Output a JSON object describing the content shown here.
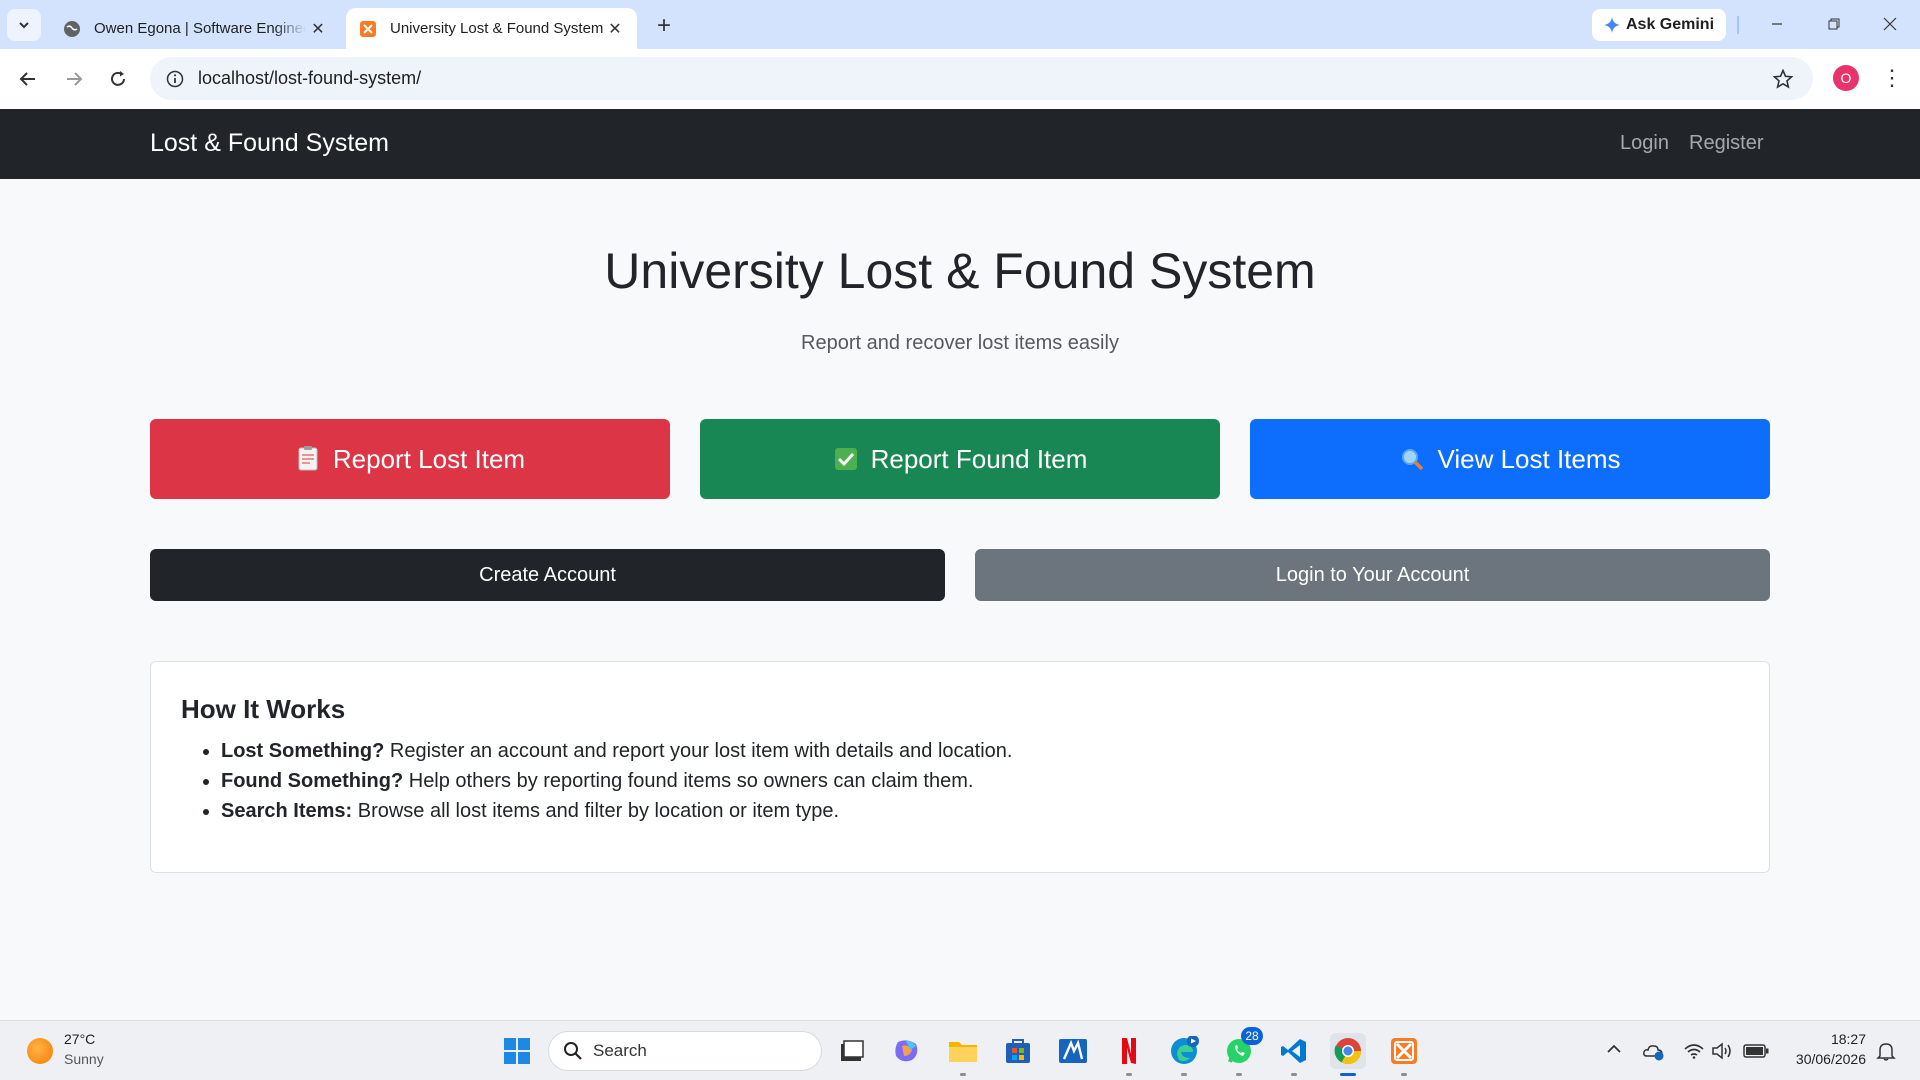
{
  "browser": {
    "tabs": [
      {
        "title": "Owen Egona | Software Engineer",
        "active": false
      },
      {
        "title": "University Lost & Found System",
        "active": true
      }
    ],
    "gemini_label": "Ask Gemini",
    "url": "localhost/lost-found-system/",
    "profile_initial": "O"
  },
  "navbar": {
    "brand": "Lost & Found System",
    "links": [
      "Login",
      "Register"
    ]
  },
  "hero": {
    "title": "University Lost & Found System",
    "subtitle": "Report and recover lost items easily"
  },
  "actions": {
    "report_lost": "Report Lost Item",
    "report_found": "Report Found Item",
    "view_lost": "View Lost Items",
    "create_account": "Create Account",
    "login_account": "Login to Your Account"
  },
  "how_it_works": {
    "title": "How It Works",
    "items": [
      {
        "label": "Lost Something?",
        "text": " Register an account and report your lost item with details and location."
      },
      {
        "label": "Found Something?",
        "text": " Help others by reporting found items so owners can claim them."
      },
      {
        "label": "Search Items:",
        "text": " Browse all lost items and filter by location or item type."
      }
    ]
  },
  "taskbar": {
    "weather_temp": "27°C",
    "weather_condition": "Sunny",
    "search_placeholder": "Search",
    "whatsapp_badge": "28",
    "time": "18:27",
    "date": "30/06/2026"
  },
  "colors": {
    "danger": "#dc3545",
    "success": "#198754",
    "primary": "#0d6efd",
    "dark": "#212529",
    "secondary": "#6c757d"
  }
}
